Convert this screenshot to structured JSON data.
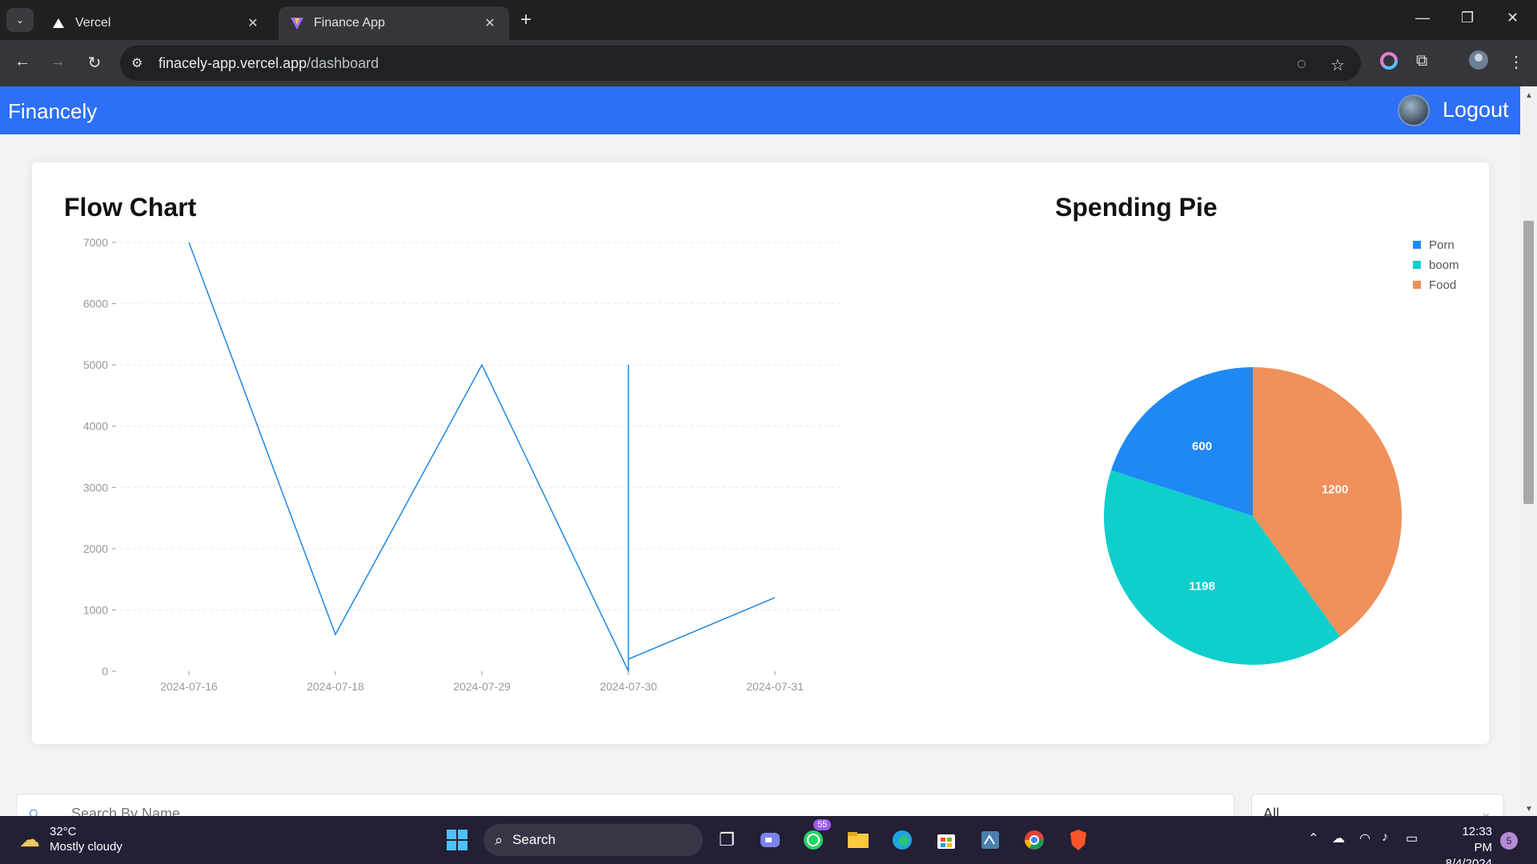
{
  "browser": {
    "tabs": [
      {
        "title": "Vercel",
        "active": false
      },
      {
        "title": "Finance App",
        "active": true
      }
    ],
    "url_host": "finacely-app.vercel.app",
    "url_path": "/dashboard"
  },
  "header": {
    "brand": "Financely",
    "logout_label": "Logout"
  },
  "flow_chart": {
    "title": "Flow Chart"
  },
  "spending_pie": {
    "title": "Spending Pie"
  },
  "chart_data": [
    {
      "type": "line",
      "title": "Flow Chart",
      "x": [
        "2024-07-16",
        "2024-07-18",
        "2024-07-29",
        "2024-07-30",
        "2024-07-30",
        "2024-07-30",
        "2024-07-31"
      ],
      "xticks": [
        "2024-07-16",
        "2024-07-18",
        "2024-07-29",
        "2024-07-30",
        "2024-07-31"
      ],
      "y": [
        7000,
        600,
        5000,
        0,
        5000,
        198,
        1200
      ],
      "yticks": [
        0,
        1000,
        2000,
        3000,
        4000,
        5000,
        6000,
        7000
      ],
      "ylim": [
        0,
        7000
      ],
      "grid": true,
      "color": "#1e88e5"
    },
    {
      "type": "pie",
      "title": "Spending Pie",
      "legend_placement": "top-right",
      "slices": [
        {
          "label": "Food",
          "value": 1200,
          "color": "#f0905a"
        },
        {
          "label": "boom",
          "value": 1198,
          "color": "#0fcfcc"
        },
        {
          "label": "Porn",
          "value": 600,
          "color": "#1e88f5"
        }
      ],
      "legend": [
        {
          "label": "Porn",
          "color": "#1e88f5"
        },
        {
          "label": "boom",
          "color": "#0fcfcc"
        },
        {
          "label": "Food",
          "color": "#f0905a"
        }
      ]
    }
  ],
  "search": {
    "placeholder": "Search By Name"
  },
  "filter": {
    "selected": "All"
  },
  "taskbar": {
    "temperature": "32°C",
    "weather": "Mostly cloudy",
    "search_label": "Search",
    "whatsapp_badge": "55",
    "time": "12:33 PM",
    "date": "8/4/2024",
    "notifications": "5"
  }
}
